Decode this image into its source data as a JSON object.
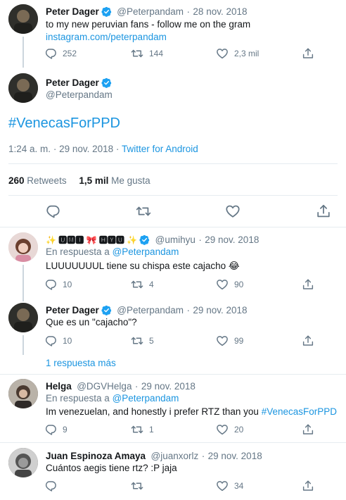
{
  "tweet1": {
    "name": "Peter Dager",
    "handle": "@Peterpandam",
    "date": "28 nov. 2018",
    "text": "to my new peruvian fans - follow me on the gram",
    "link": "instagram.com/peterpandam",
    "replies": "252",
    "retweets": "144",
    "likes": "2,3 mil"
  },
  "main": {
    "name": "Peter Dager",
    "handle": "@Peterpandam",
    "hashtag": "#VenecasForPPD",
    "time": "1:24 a. m.",
    "date": "29 nov. 2018",
    "source": "Twitter for Android",
    "retweets_count": "260",
    "retweets_label": "Retweets",
    "likes_count": "1,5 mil",
    "likes_label": "Me gusta"
  },
  "reply1": {
    "name": "✨ 🆄🅼🅸 🎀 🅷🆈🆄 ✨",
    "handle": "@umihyu",
    "date": "29 nov. 2018",
    "reply_prefix": "En respuesta a",
    "reply_to": "@Peterpandam",
    "text": "LUUUUUUUL tiene su chispa este cajacho 😂",
    "replies": "10",
    "retweets": "4",
    "likes": "90"
  },
  "reply2": {
    "name": "Peter Dager",
    "handle": "@Peterpandam",
    "date": "29 nov. 2018",
    "text": "Que es un \"cajacho\"?",
    "replies": "10",
    "retweets": "5",
    "likes": "99"
  },
  "more_replies": "1 respuesta más",
  "reply3": {
    "name": "Helga",
    "handle": "@DGVHelga",
    "date": "29 nov. 2018",
    "reply_prefix": "En respuesta a",
    "reply_to": "@Peterpandam",
    "text": "Im venezuelan, and honestly i prefer RTZ than you",
    "hashtag": "#VenecasForPPD",
    "replies": "9",
    "retweets": "1",
    "likes": "20"
  },
  "reply4": {
    "name": "Juan Espinoza Amaya",
    "handle": "@juanxorlz",
    "date": "29 nov. 2018",
    "text": "Cuántos aegis tiene rtz? :P jaja",
    "likes": "34"
  },
  "dot": "·",
  "colors": {
    "link": "#1b95e0",
    "muted": "#657786",
    "verified": "#1da1f2",
    "divider": "#e6ecf0"
  },
  "icons": [
    "reply-icon",
    "retweet-icon",
    "like-icon",
    "share-icon",
    "verified-icon"
  ]
}
